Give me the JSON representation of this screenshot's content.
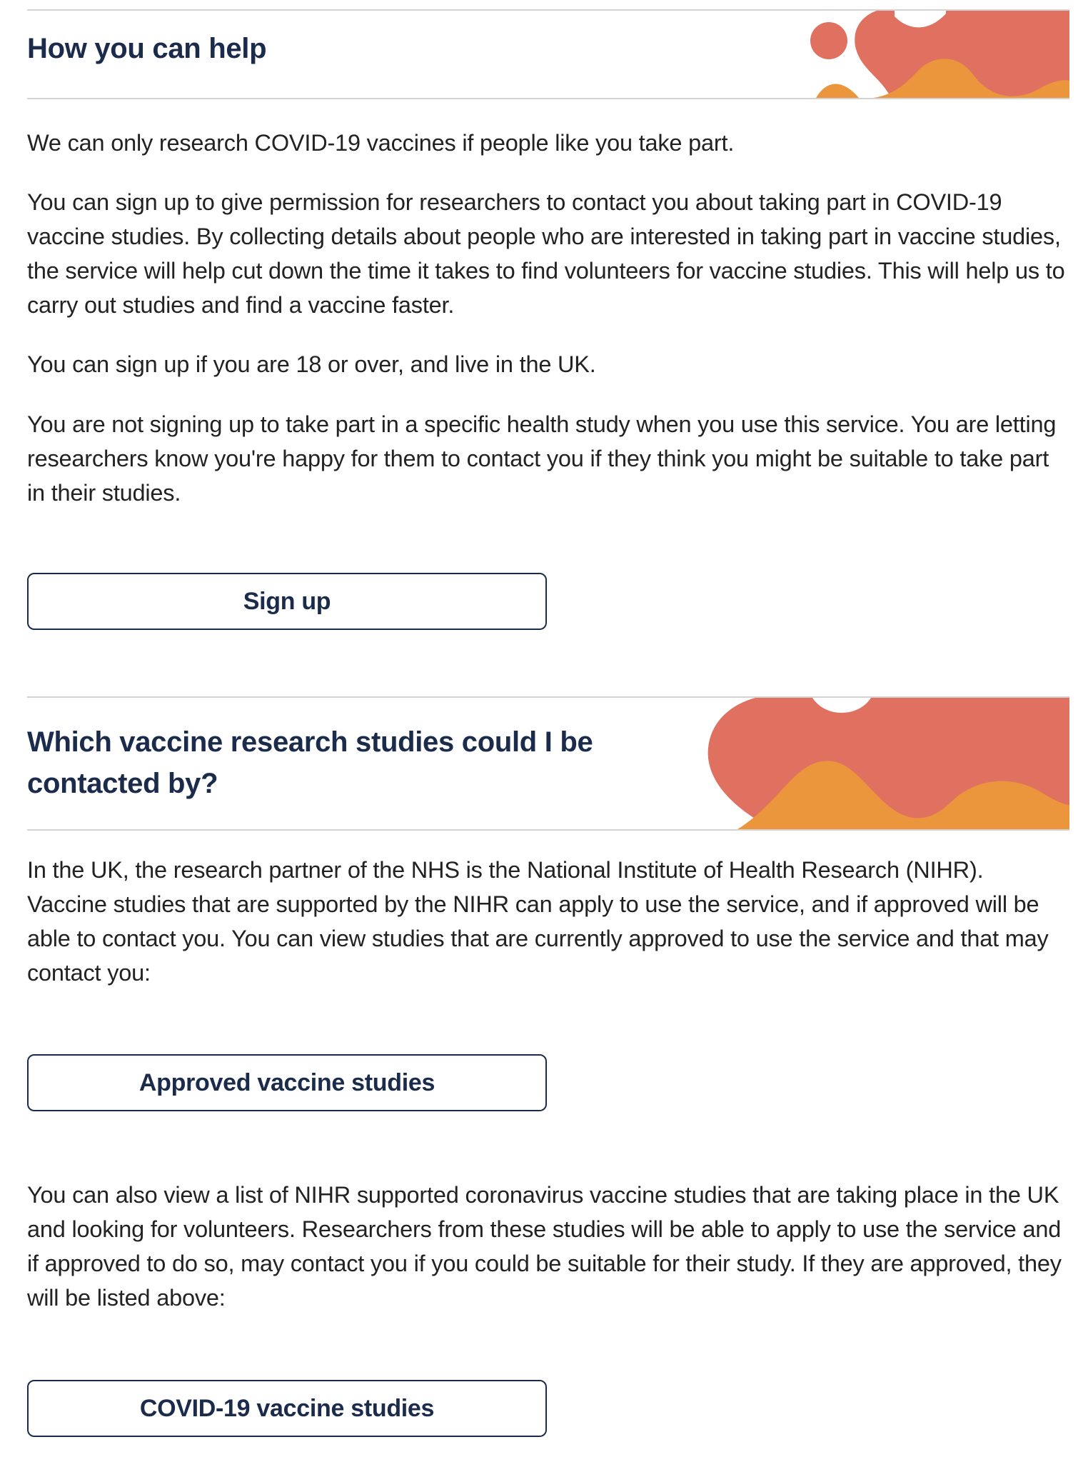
{
  "colors": {
    "heading": "#1b2b4b",
    "body_text": "#222222",
    "divider": "#d3d3d3",
    "blob_coral": "#e07060",
    "blob_orange": "#eb963c",
    "button_border": "#1b2b4b"
  },
  "section_help": {
    "heading": "How you can help",
    "decoration": "coral-orange-blobs",
    "paragraphs": [
      "We can only research COVID-19 vaccines if people like you take part.",
      "You can sign up to give permission for researchers to contact you about taking part in COVID-19 vaccine studies. By collecting details about people who are interested in taking part in vaccine studies, the service will help cut down the time it takes to find volunteers for vaccine studies. This will help us to carry out studies and find a vaccine faster.",
      "You can sign up if you are 18 or over, and live in the UK.",
      "You are not signing up to take part in a specific health study when you use this service. You are letting researchers know you're happy for them to contact you if they think you might be suitable to take part in their studies."
    ],
    "signup_button": "Sign up"
  },
  "section_studies": {
    "heading": "Which vaccine research studies could I be contacted by?",
    "decoration": "coral-orange-blobs",
    "intro": "In the UK, the research partner of the NHS is the National Institute of Health Research (NIHR). Vaccine studies that are supported by the NIHR can apply to use the service, and if approved will be able to contact you. You can view studies that are currently approved to use the service and that may contact you:",
    "approved_button": "Approved vaccine studies",
    "more_text": "You can also view a list of NIHR supported coronavirus vaccine studies that are taking place in the UK and looking for volunteers.  Researchers from these studies will be able to apply to use the service and if approved to do so, may contact you if you could be suitable for their study. If they are approved, they will be listed above:",
    "covid_button": "COVID-19 vaccine studies"
  }
}
